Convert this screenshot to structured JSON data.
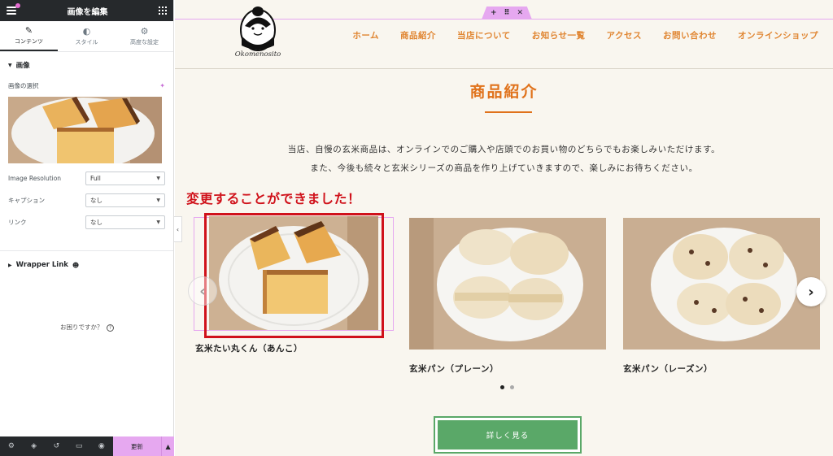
{
  "editor": {
    "title": "画像を編集",
    "tabs": [
      {
        "label": "コンテンツ",
        "icon": "pencil-icon"
      },
      {
        "label": "スタイル",
        "icon": "half-circle-icon"
      },
      {
        "label": "高度な設定",
        "icon": "gear-icon"
      }
    ],
    "image_section": {
      "heading": "画像",
      "choose_label": "画像の選択",
      "fields": [
        {
          "label": "Image Resolution",
          "value": "Full"
        },
        {
          "label": "キャプション",
          "value": "なし"
        },
        {
          "label": "リンク",
          "value": "なし"
        }
      ]
    },
    "wrapper_section": {
      "heading": "Wrapper Link"
    },
    "help": "お困りですか？",
    "footer": {
      "update_label": "更新"
    }
  },
  "site": {
    "logo_text": "Okomenosito",
    "nav": [
      "ホーム",
      "商品紹介",
      "当店について",
      "お知らせ一覧",
      "アクセス",
      "お問い合わせ",
      "オンラインショップ"
    ],
    "page_title": "商品紹介",
    "description": [
      "当店、自慢の玄米商品は、オンラインでのご購入や店頭でのお買い物のどちらでもお楽しみいただけます。",
      "また、今後も続々と玄米シリーズの商品を作り上げていきますので、楽しみにお待ちください。"
    ],
    "annotation": "変更することができました！",
    "products": [
      {
        "name": "玄米たい丸くん（あんこ）"
      },
      {
        "name": "玄米パン（プレーン）"
      },
      {
        "name": "玄米パン（レーズン）"
      }
    ],
    "carousel": {
      "active_dot": 1,
      "dots": 2
    },
    "more_button": "詳しく見る"
  },
  "colors": {
    "accent_orange": "#e0721b",
    "nav_orange": "#e08531",
    "annotation_red": "#d0121b",
    "button_green": "#5aa868",
    "editor_pink": "#e6a8f0",
    "editor_dark": "#26292c"
  }
}
